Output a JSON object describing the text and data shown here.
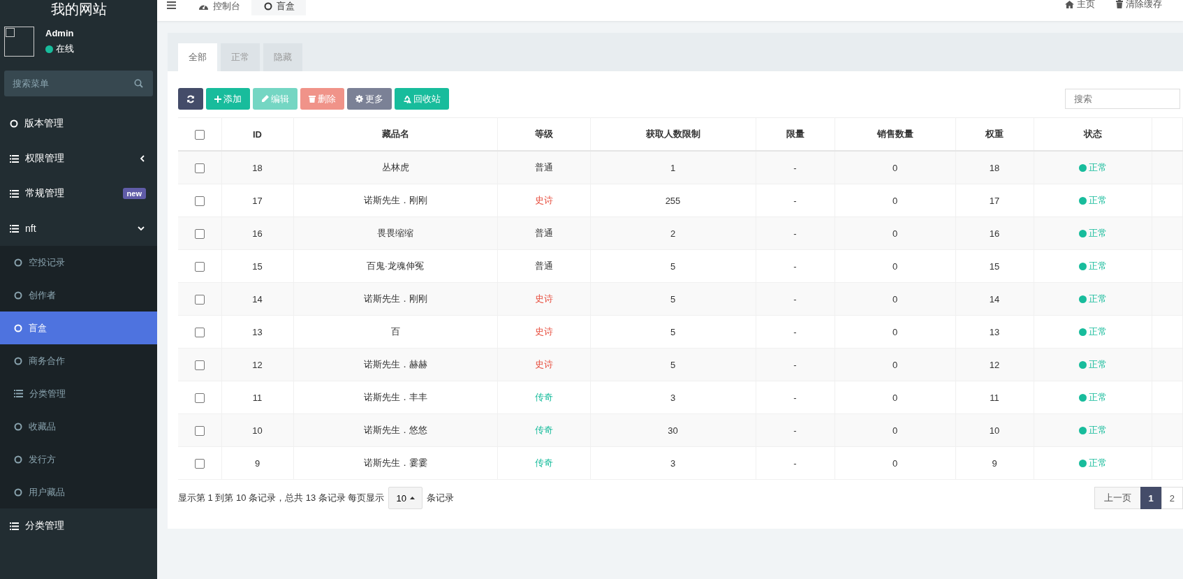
{
  "sidebar": {
    "site_title": "我的网站",
    "user": {
      "name": "Admin",
      "status": {
        "text": "在线",
        "color": "#18bc9c"
      }
    },
    "search": {
      "placeholder": "搜索菜单"
    },
    "items": [
      {
        "label": "版本管理",
        "kind": "circle"
      },
      {
        "label": "权限管理",
        "kind": "list",
        "expanded": false
      },
      {
        "label": "常规管理",
        "kind": "list",
        "badge": "new"
      },
      {
        "label": "nft",
        "kind": "list",
        "expanded": true,
        "children": [
          {
            "label": "空投记录",
            "kind": "circle",
            "selected": false
          },
          {
            "label": "创作者",
            "kind": "circle",
            "selected": false
          },
          {
            "label": "盲盒",
            "kind": "circle",
            "selected": true
          },
          {
            "label": "商务合作",
            "kind": "circle",
            "selected": false
          },
          {
            "label": "分类管理",
            "kind": "list",
            "selected": false
          },
          {
            "label": "收藏品",
            "kind": "circle",
            "selected": false
          },
          {
            "label": "发行方",
            "kind": "circle",
            "selected": false
          },
          {
            "label": "用户藏品",
            "kind": "circle",
            "selected": false
          }
        ]
      },
      {
        "label": "分类管理",
        "kind": "list"
      }
    ]
  },
  "topbar": {
    "tabs": [
      {
        "label": "控制台",
        "kind": "dashboard",
        "selected": false
      },
      {
        "label": "盲盒",
        "kind": "circle",
        "selected": true
      }
    ],
    "links": [
      {
        "label": "主页",
        "kind": "home"
      },
      {
        "label": "清除缓存",
        "kind": "trash"
      }
    ]
  },
  "filter_tabs": [
    {
      "label": "全部",
      "selected": true
    },
    {
      "label": "正常",
      "selected": false
    },
    {
      "label": "隐藏",
      "selected": false
    }
  ],
  "toolbar": {
    "buttons": [
      {
        "kind": "refresh",
        "disabled": false
      },
      {
        "kind": "add",
        "label": "添加",
        "disabled": false
      },
      {
        "kind": "edit",
        "label": "编辑",
        "disabled": true
      },
      {
        "kind": "delete",
        "label": "删除",
        "disabled": true
      },
      {
        "kind": "more",
        "label": "更多",
        "disabled": false
      },
      {
        "kind": "recycle",
        "label": "回收站",
        "disabled": false
      }
    ],
    "search": {
      "placeholder": "搜索"
    }
  },
  "table": {
    "select_all": {
      "checked": false
    },
    "columns": [
      "ID",
      "藏品名",
      "等级",
      "获取人数限制",
      "限量",
      "销售数量",
      "权重",
      "状态"
    ],
    "rows": [
      {
        "checked": false,
        "id": "18",
        "name": "丛林虎",
        "grade": {
          "text": "普通",
          "kind": "common"
        },
        "limit": "1",
        "quantity": "-",
        "sold": "0",
        "weight": "18",
        "status": {
          "text": "正常",
          "color": "#18bc9c"
        }
      },
      {
        "checked": false,
        "id": "17",
        "name": "诺斯先生．刚刚",
        "grade": {
          "text": "史诗",
          "kind": "epic"
        },
        "limit": "255",
        "quantity": "-",
        "sold": "0",
        "weight": "17",
        "status": {
          "text": "正常",
          "color": "#18bc9c"
        }
      },
      {
        "checked": false,
        "id": "16",
        "name": "畏畏缩缩",
        "grade": {
          "text": "普通",
          "kind": "common"
        },
        "limit": "2",
        "quantity": "-",
        "sold": "0",
        "weight": "16",
        "status": {
          "text": "正常",
          "color": "#18bc9c"
        }
      },
      {
        "checked": false,
        "id": "15",
        "name": "百鬼·龙魂伸冤",
        "grade": {
          "text": "普通",
          "kind": "common"
        },
        "limit": "5",
        "quantity": "-",
        "sold": "0",
        "weight": "15",
        "status": {
          "text": "正常",
          "color": "#18bc9c"
        }
      },
      {
        "checked": false,
        "id": "14",
        "name": "诺斯先生．刚刚",
        "grade": {
          "text": "史诗",
          "kind": "epic"
        },
        "limit": "5",
        "quantity": "-",
        "sold": "0",
        "weight": "14",
        "status": {
          "text": "正常",
          "color": "#18bc9c"
        }
      },
      {
        "checked": false,
        "id": "13",
        "name": "百",
        "grade": {
          "text": "史诗",
          "kind": "epic"
        },
        "limit": "5",
        "quantity": "-",
        "sold": "0",
        "weight": "13",
        "status": {
          "text": "正常",
          "color": "#18bc9c"
        }
      },
      {
        "checked": false,
        "id": "12",
        "name": "诺斯先生．赫赫",
        "grade": {
          "text": "史诗",
          "kind": "epic"
        },
        "limit": "5",
        "quantity": "-",
        "sold": "0",
        "weight": "12",
        "status": {
          "text": "正常",
          "color": "#18bc9c"
        }
      },
      {
        "checked": false,
        "id": "11",
        "name": "诺斯先生．丰丰",
        "grade": {
          "text": "传奇",
          "kind": "legendary"
        },
        "limit": "3",
        "quantity": "-",
        "sold": "0",
        "weight": "11",
        "status": {
          "text": "正常",
          "color": "#18bc9c"
        }
      },
      {
        "checked": false,
        "id": "10",
        "name": "诺斯先生．悠悠",
        "grade": {
          "text": "传奇",
          "kind": "legendary"
        },
        "limit": "30",
        "quantity": "-",
        "sold": "0",
        "weight": "10",
        "status": {
          "text": "正常",
          "color": "#18bc9c"
        }
      },
      {
        "checked": false,
        "id": "9",
        "name": "诺斯先生．霎霎",
        "grade": {
          "text": "传奇",
          "kind": "legendary"
        },
        "limit": "3",
        "quantity": "-",
        "sold": "0",
        "weight": "9",
        "status": {
          "text": "正常",
          "color": "#18bc9c"
        }
      }
    ]
  },
  "footer": {
    "summary": "显示第 1 到第 10 条记录，总共 13 条记录 每页显示",
    "page_size": "10",
    "suffix": "条记录",
    "pages": [
      {
        "label": "上一页",
        "selected": false
      },
      {
        "label": "1",
        "selected": true
      },
      {
        "label": "2",
        "selected": false
      }
    ]
  }
}
